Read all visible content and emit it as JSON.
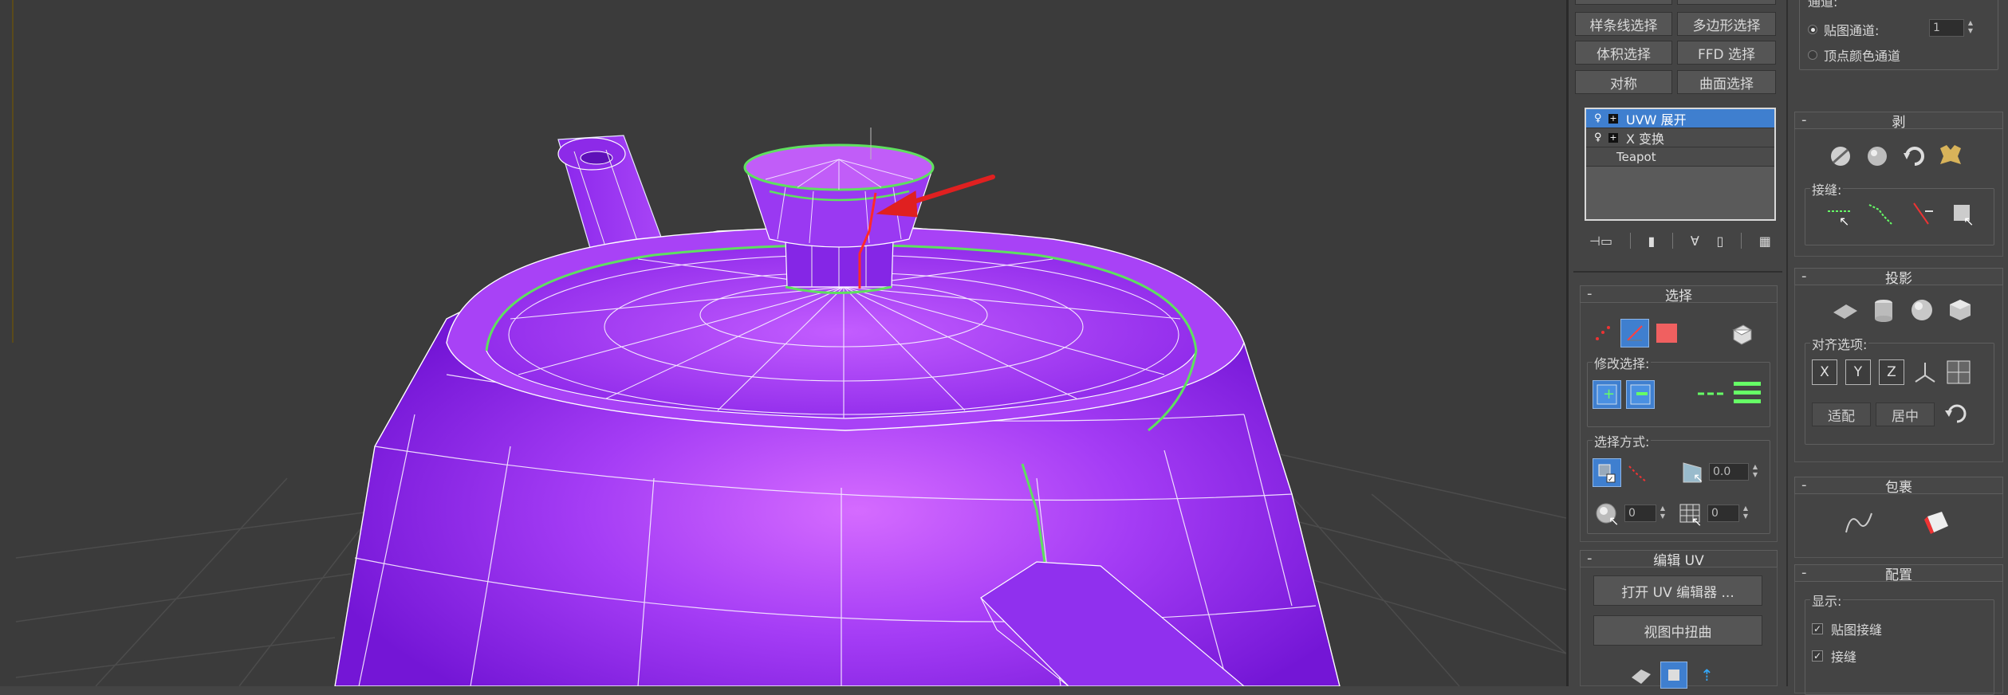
{
  "modifier_buttons": [
    {
      "label": "样条线选择"
    },
    {
      "label": "多边形选择"
    },
    {
      "label": "体积选择"
    },
    {
      "label": "FFD 选择"
    },
    {
      "label": "对称"
    },
    {
      "label": "曲面选择"
    }
  ],
  "stack": {
    "items": [
      {
        "label": "UVW 展开",
        "selected": true
      },
      {
        "label": "X 变换",
        "selected": false
      },
      {
        "label": "Teapot",
        "selected": false
      }
    ]
  },
  "selection_rollout": {
    "title": "选择",
    "modify_selection_label": "修改选择:",
    "select_by_label": "选择方式:",
    "angle_value": "0.0",
    "spinner_a": "0",
    "spinner_b": "0"
  },
  "edit_uv_rollout": {
    "title": "编辑 UV",
    "open_editor_label": "打开 UV 编辑器 ...",
    "tweak_label": "视图中扭曲"
  },
  "channel": {
    "title": "通道:",
    "map_channel_label": "贴图通道:",
    "map_channel_value": "1",
    "vertex_color_label": "顶点颜色通道"
  },
  "peel_rollout": {
    "title": "剥",
    "seams_label": "接缝:"
  },
  "projection_rollout": {
    "title": "投影",
    "align_label": "对齐选项:",
    "x": "X",
    "y": "Y",
    "z": "Z",
    "fit_label": "适配",
    "center_label": "居中"
  },
  "wrap_rollout": {
    "title": "包裹"
  },
  "config_rollout": {
    "title": "配置",
    "display_label": "显示:",
    "map_seams_label": "贴图接缝",
    "seams_label": "接缝"
  },
  "colors": {
    "viewport_bg": "#3b3b3b",
    "teapot": "#9b2ff0",
    "seam_green": "#5fe05f",
    "accent_blue": "#3f7fcf",
    "arrow_red": "#e02020"
  }
}
